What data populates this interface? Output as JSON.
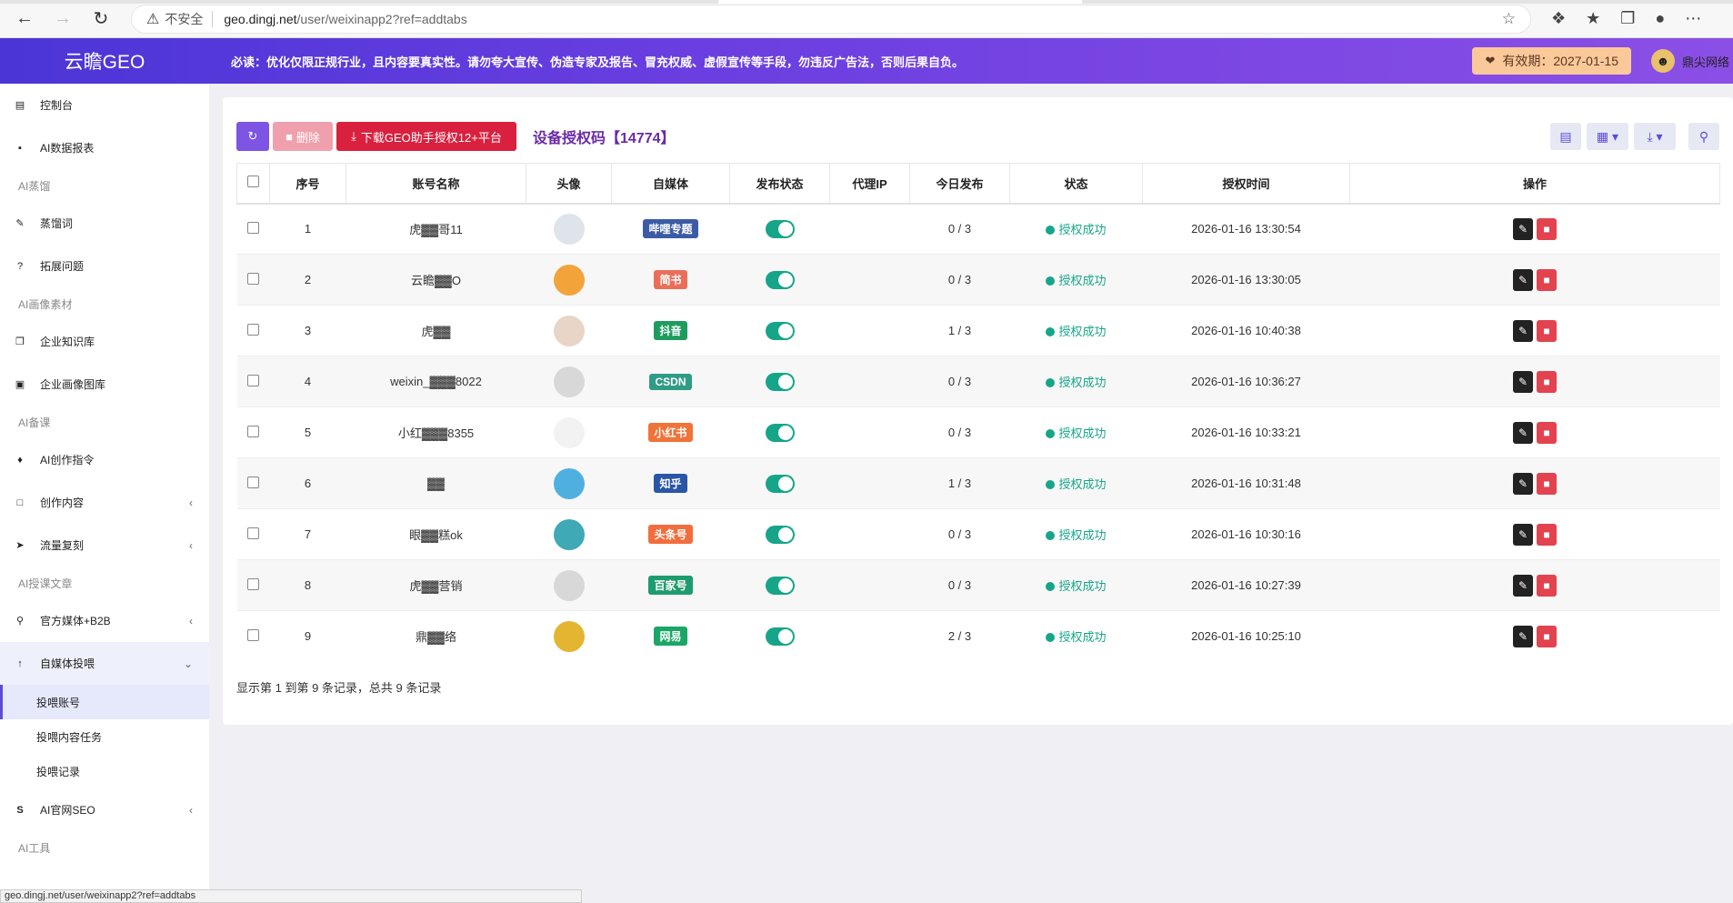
{
  "browser": {
    "insecure_label": "不安全",
    "url_host": "geo.dingj.net",
    "url_path": "/user/weixinapp2?ref=addtabs",
    "status_url": "geo.dingj.net/user/weixinapp2?ref=addtabs"
  },
  "header": {
    "brand": "云瞻GEO",
    "notice": "必读：优化仅限正规行业，且内容要真实性。请勿夸大宣传、伪造专家及报告、冒充权威、虚假宣传等手段，勿违反广告法，否则后果自负。",
    "expiry": "有效期：2027-01-15",
    "user_name": "鼎尖网络"
  },
  "sidebar": {
    "dashboard": "控制台",
    "ai_report": "AI数据报表",
    "group_distill": "AI蒸馏",
    "distill_words": "蒸馏词",
    "expand_questions": "拓展问题",
    "group_material": "AI画像素材",
    "knowledge_base": "企业知识库",
    "image_library": "企业画像图库",
    "group_prepare": "AI备课",
    "ai_commands": "AI创作指令",
    "create_content": "创作内容",
    "traffic_copy": "流量复刻",
    "group_articles": "AI授课文章",
    "official_media": "官方媒体+B2B",
    "self_media": "自媒体投喂",
    "sub_accounts": "投喂账号",
    "sub_tasks": "投喂内容任务",
    "sub_records": "投喂记录",
    "ai_seo": "AI官网SEO",
    "group_tools": "AI工具"
  },
  "toolbar": {
    "delete_label": "删除",
    "download_label": "下载GEO助手授权12+平台",
    "title": "设备授权码【14774】"
  },
  "table": {
    "headers": [
      "序号",
      "账号名称",
      "头像",
      "自媒体",
      "发布状态",
      "代理IP",
      "今日发布",
      "状态",
      "授权时间",
      "操作"
    ],
    "rows": [
      {
        "no": "1",
        "name": "虎▓▓哥11",
        "media": "哔哩专题",
        "media_color": "#3b5ba5",
        "today": "0 / 3",
        "status": "授权成功",
        "time": "2026-01-16 13:30:54",
        "avatar_color": "#dfe3ea"
      },
      {
        "no": "2",
        "name": "云瞻▓▓O",
        "media": "简书",
        "media_color": "#ea6f5a",
        "today": "0 / 3",
        "status": "授权成功",
        "time": "2026-01-16 13:30:05",
        "avatar_color": "#f2a33a"
      },
      {
        "no": "3",
        "name": "虎▓▓",
        "media": "抖音",
        "media_color": "#1e9c5e",
        "today": "1 / 3",
        "status": "授权成功",
        "time": "2026-01-16 10:40:38",
        "avatar_color": "#e8d5c8"
      },
      {
        "no": "4",
        "name": "weixin_▓▓▓8022",
        "media": "CSDN",
        "media_color": "#2f9c86",
        "today": "0 / 3",
        "status": "授权成功",
        "time": "2026-01-16 10:36:27",
        "avatar_color": "#d8d8d8"
      },
      {
        "no": "5",
        "name": "小红▓▓▓8355",
        "media": "小红书",
        "media_color": "#f0733a",
        "today": "0 / 3",
        "status": "授权成功",
        "time": "2026-01-16 10:33:21",
        "avatar_color": "#f2f2f2"
      },
      {
        "no": "6",
        "name": "▓▓",
        "media": "知乎",
        "media_color": "#2a56a6",
        "today": "1 / 3",
        "status": "授权成功",
        "time": "2026-01-16 10:31:48",
        "avatar_color": "#4fb0e0"
      },
      {
        "no": "7",
        "name": "眼▓▓糕ok",
        "media": "头条号",
        "media_color": "#f26d3d",
        "today": "0 / 3",
        "status": "授权成功",
        "time": "2026-01-16 10:30:16",
        "avatar_color": "#3fa9b5"
      },
      {
        "no": "8",
        "name": "虎▓▓营销",
        "media": "百家号",
        "media_color": "#1f9c6e",
        "today": "0 / 3",
        "status": "授权成功",
        "time": "2026-01-16 10:27:39",
        "avatar_color": "#d8d8d8"
      },
      {
        "no": "9",
        "name": "鼎▓▓络",
        "media": "网易",
        "media_color": "#1aa666",
        "today": "2 / 3",
        "status": "授权成功",
        "time": "2026-01-16 10:25:10",
        "avatar_color": "#e3b530"
      }
    ]
  },
  "footer": {
    "pagination_text": "显示第 1 到第 9 条记录，总共 9 条记录"
  },
  "colors": {
    "header_gradient_start": "#4b35d6",
    "header_gradient_end": "#8b4fe6",
    "success": "#17a589",
    "danger": "#e2434f"
  }
}
